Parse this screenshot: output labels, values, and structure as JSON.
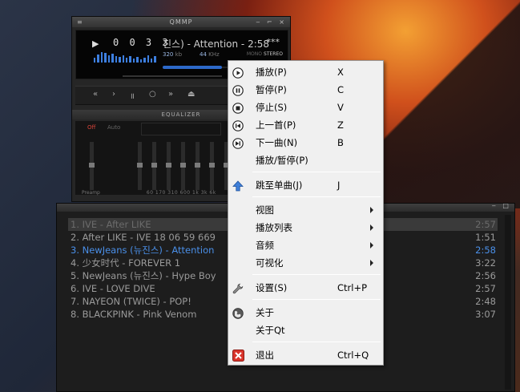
{
  "player": {
    "title": "QMMP",
    "menu_glyph": "≡",
    "window_controls": "‒ ⌐ ×",
    "play_indicator": "▶",
    "time": "0 0 3 3",
    "song_title": "진스) - Attention - 2:58",
    "stars": "***",
    "bitrate_value": "320",
    "bitrate_unit": "kb",
    "samplerate_value": "44",
    "samplerate_unit": "KHz",
    "mono_label": "MONO",
    "stereo_label": "STEREO",
    "controls": {
      "prev": "«",
      "play": "›",
      "pause": "॥",
      "stop": "○",
      "next": "»",
      "eject": "⏏"
    }
  },
  "equalizer": {
    "title": "EQUALIZER",
    "off_label": "Off",
    "auto_label": "Auto",
    "preamp_label": "Preamp",
    "freq_labels": "60   170  310  600   1k    3k   6k"
  },
  "playlist": {
    "window_controls": "‒ □",
    "items": [
      {
        "title": "1. IVE - After LIKE",
        "duration": "2:57"
      },
      {
        "title": "2. After LIKE - IVE 18 06 59 669",
        "duration": "1:51"
      },
      {
        "title": "3. NewJeans (뉴진스) - Attention",
        "duration": "2:58"
      },
      {
        "title": "4. 少女时代 - FOREVER 1",
        "duration": "3:22"
      },
      {
        "title": "5. NewJeans (뉴진스) - Hype Boy",
        "duration": "2:56"
      },
      {
        "title": "6. IVE - LOVE DIVE",
        "duration": "2:57"
      },
      {
        "title": "7. NAYEON (TWICE) - POP!",
        "duration": "2:48"
      },
      {
        "title": "8. BLACKPINK - Pink Venom",
        "duration": "3:07"
      }
    ],
    "selected_index": 0,
    "current_index": 2
  },
  "context_menu": {
    "play": {
      "label": "播放(P)",
      "shortcut": "X"
    },
    "pause": {
      "label": "暂停(P)",
      "shortcut": "C"
    },
    "stop": {
      "label": "停止(S)",
      "shortcut": "V"
    },
    "previous": {
      "label": "上一首(P)",
      "shortcut": "Z"
    },
    "next": {
      "label": "下一曲(N)",
      "shortcut": "B"
    },
    "play_pause": {
      "label": "播放/暂停(P)"
    },
    "jump": {
      "label": "跳至单曲(J)",
      "shortcut": "J"
    },
    "view": {
      "label": "视图"
    },
    "playlist": {
      "label": "播放列表"
    },
    "audio": {
      "label": "音频"
    },
    "visualization": {
      "label": "可视化"
    },
    "settings": {
      "label": "设置(S)",
      "shortcut": "Ctrl+P"
    },
    "about": {
      "label": "关于"
    },
    "about_qt": {
      "label": "关于Qt"
    },
    "exit": {
      "label": "退出",
      "shortcut": "Ctrl+Q"
    }
  },
  "colors": {
    "accent": "#3d7fe0",
    "current_track": "#4a8fe8",
    "eq_off": "#d8443a",
    "exit_icon": "#d9342b"
  },
  "icons": {
    "play": "play-circle-icon",
    "pause": "pause-circle-icon",
    "stop": "stop-circle-icon",
    "previous": "skip-back-circle-icon",
    "next": "skip-forward-circle-icon",
    "jump": "up-arrow-icon",
    "settings": "wrench-icon",
    "about": "globe-icon",
    "exit": "close-red-icon"
  }
}
